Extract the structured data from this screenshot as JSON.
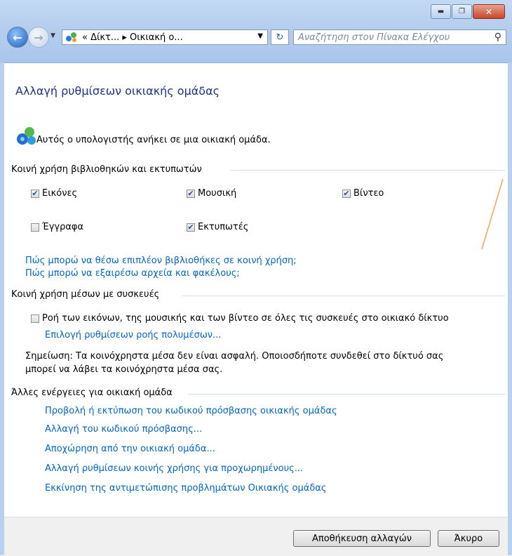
{
  "window": {
    "min_glyph": "▬",
    "max_glyph": "❐",
    "close_glyph": "✕"
  },
  "nav": {
    "address_text": "«  Δίκτ...  ▸  Οικιακή ο...",
    "address_dropdown": "▼",
    "refresh_glyph": "↻",
    "search_placeholder": "Αναζήτηση στον Πίνακα Ελέγχου"
  },
  "page": {
    "title": "Αλλαγή ρυθμίσεων οικιακής ομάδας",
    "membership_text": "Αυτός ο υπολογιστής ανήκει σε μια οικιακή ομάδα."
  },
  "libraries": {
    "heading": "Κοινή χρήση βιβλιοθηκών και εκτυπωτών",
    "items": [
      {
        "label": "Εικόνες",
        "checked": true
      },
      {
        "label": "Μουσική",
        "checked": true
      },
      {
        "label": "Βίντεο",
        "checked": true
      },
      {
        "label": "Έγγραφα",
        "checked": false
      },
      {
        "label": "Εκτυπωτές",
        "checked": true
      }
    ],
    "links": [
      "Πώς μπορώ να θέσω επιπλέον βιβλιοθήκες σε κοινή χρήση;",
      "Πώς μπορώ να εξαιρέσω αρχεία και φακέλους;"
    ]
  },
  "media": {
    "heading": "Κοινή χρήση μέσων με συσκευές",
    "stream_label": "Ροή των εικόνων, της μουσικής και των βίντεο σε όλες τις συσκευές στο οικιακό δίκτυο",
    "stream_checked": false,
    "stream_link": "Επιλογή ρυθμίσεων ροής πολυμέσων...",
    "note_line1": "Σημείωση: Τα κοινόχρηστα μέσα δεν είναι ασφαλή. Οποιοσδήποτε συνδεθεί στο δίκτυό σας",
    "note_line2": "μπορεί να λάβει τα κοινόχρηστα μέσα σας."
  },
  "other": {
    "heading": "Άλλες ενέργειες για οικιακή ομάδα",
    "links": [
      "Προβολή ή εκτύπωση του κωδικού πρόσβασης οικιακής ομάδας",
      "Αλλαγή του κωδικού πρόσβασης...",
      "Αποχώρηση από την οικιακή ομάδα...",
      "Αλλαγή ρυθμίσεων κοινής χρήσης για προχωρημένους...",
      "Εκκίνηση της αντιμετώπισης προβλημάτων Οικιακής ομάδας"
    ]
  },
  "footer": {
    "save_label": "Αποθήκευση αλλαγών",
    "cancel_label": "Άκυρο"
  },
  "colors": {
    "link": "#0066cc",
    "title": "#1e3287",
    "annotation_line": "#f2a65a"
  }
}
